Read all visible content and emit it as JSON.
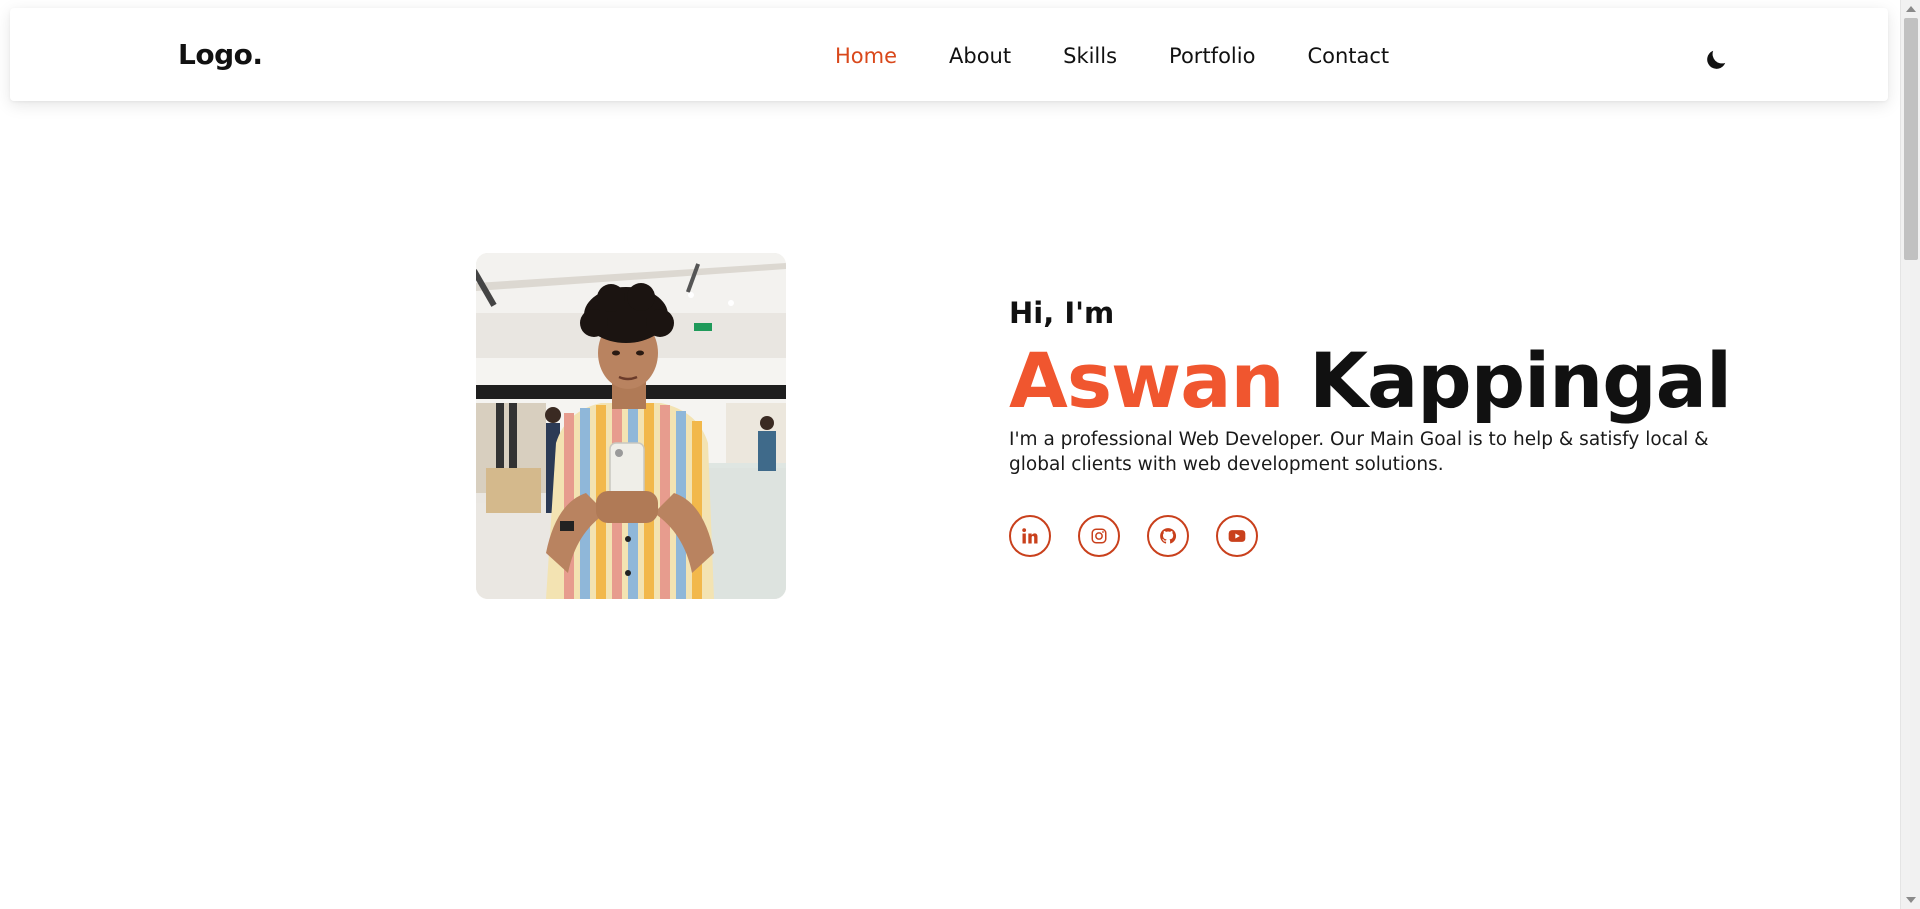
{
  "header": {
    "logo": "Logo.",
    "nav": {
      "items": [
        {
          "label": "Home",
          "active": true
        },
        {
          "label": "About",
          "active": false
        },
        {
          "label": "Skills",
          "active": false
        },
        {
          "label": "Portfolio",
          "active": false
        },
        {
          "label": "Contact",
          "active": false
        }
      ]
    },
    "theme_toggle_icon": "moon-icon"
  },
  "hero": {
    "greeting": "Hi, I'm",
    "first_name": "Aswan",
    "last_name": "Kappingal",
    "tagline": "I'm a professional Web Developer. Our Main Goal is to help & satisfy local & global clients with web development solutions.",
    "socials": [
      {
        "icon": "linkedin-icon"
      },
      {
        "icon": "instagram-icon"
      },
      {
        "icon": "github-icon"
      },
      {
        "icon": "youtube-icon"
      }
    ]
  },
  "colors": {
    "accent": "#f0562f",
    "accent_dark": "#c9401c",
    "text": "#111111"
  }
}
